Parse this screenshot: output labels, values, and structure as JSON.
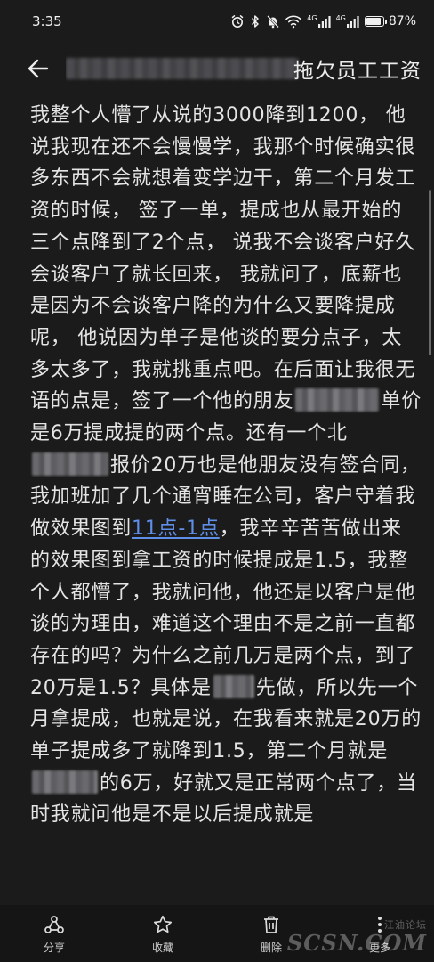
{
  "status_bar": {
    "time": "3:35",
    "signal1": "4G",
    "signal2": "4G",
    "battery_text": "87%",
    "battery_level": 0.87,
    "icons": [
      "alarm-icon",
      "bluetooth-icon",
      "mute-icon",
      "wifi-icon",
      "signal-icon",
      "signal-icon",
      "battery-icon"
    ]
  },
  "header": {
    "title_visible": "拖欠员工工资",
    "back_icon": "arrow-left-icon"
  },
  "content": {
    "segments": [
      "我整个人懵了从说的3000降到1200， 他说我现在还不会慢慢学，我那个时候确实很多东西不会就想着变学边干，第二个月发工资的时候， 签了一单，提成也从最开始的三个点降到了2个点， 说我不会谈客户好久会谈客户了就长回来， 我就问了，底薪也是因为不会谈客户降的为什么又要降提成呢， 他说因为单子是他谈的要分点子，太多太多了，我就挑重点吧。在后面让我很无语的点是，签了一个他的朋友",
      "单价是6万提成提的两个点。还有一个北",
      "报价20万也是他朋友没有签合同，我加班加了几个通宵睡在公司，客户守着我做效果图到",
      "11点-1点",
      "，我辛辛苦苦做出来的效果图到拿工资的时候提成是1.5，我整个人都懵了，我就问他，他还是以客户是他谈的为理由，难道这个理由不是之前一直都存在的吗？为什么之前几万是两个点，到了20万是1.5？具体是",
      "先做，所以先一个月拿提成，也就是说，在我看来就是20万的单子提成多了就降到1.5，第二个月就是",
      "的6万，好就又是正常两个点了，当时我就问他是不是以后提成就是"
    ]
  },
  "toolbar": {
    "items": [
      {
        "label": "分享",
        "icon": "share-icon"
      },
      {
        "label": "收藏",
        "icon": "star-icon"
      },
      {
        "label": "删除",
        "icon": "trash-icon"
      },
      {
        "label": "更多",
        "icon": "more-icon"
      }
    ]
  },
  "watermark": {
    "cn": "江油论坛",
    "en": "SCSN.COM"
  }
}
